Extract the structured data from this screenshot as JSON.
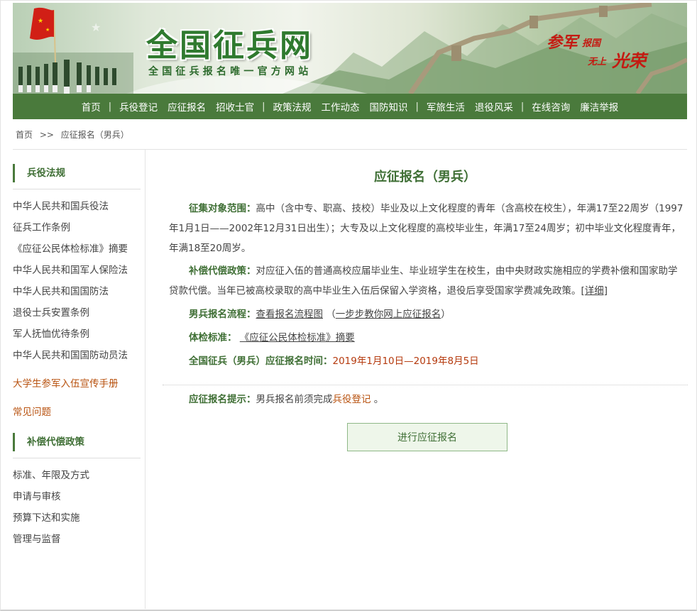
{
  "header": {
    "logo_title": "全国征兵网",
    "logo_subtitle": "全国征兵报名唯一官方网站",
    "slogan": {
      "part1": "参军",
      "part2": "报国",
      "part3": "无上",
      "part4": "光荣"
    }
  },
  "nav": {
    "items": [
      "首页",
      "兵役登记",
      "应征报名",
      "招收士官",
      "政策法规",
      "工作动态",
      "国防知识",
      "军旅生活",
      "退役风采",
      "在线咨询",
      "廉洁举报"
    ],
    "separator": "|"
  },
  "breadcrumb": {
    "home": "首页",
    "sep": ">>",
    "current": "应征报名（男兵）"
  },
  "sidebar": {
    "section1_title": "兵役法规",
    "section1_items": [
      "中华人民共和国兵役法",
      "征兵工作条例",
      "《应征公民体检标准》摘要",
      "中华人民共和国军人保险法",
      "中华人民共和国国防法",
      "退役士兵安置条例",
      "军人抚恤优待条例",
      "中华人民共和国国防动员法"
    ],
    "highlight_items": [
      "大学生参军入伍宣传手册",
      "常见问题"
    ],
    "section2_title": "补偿代偿政策",
    "section2_items": [
      "标准、年限及方式",
      "申请与审核",
      "预算下达和实施",
      "管理与监督"
    ]
  },
  "main": {
    "title": "应征报名（男兵）",
    "scope_label": "征集对象范围：",
    "scope_text": "高中（含中专、职高、技校）毕业及以上文化程度的青年（含高校在校生），年满17至22周岁（1997年1月1日——2002年12月31日出生）；大专及以上文化程度的高校毕业生，年满17至24周岁；初中毕业文化程度青年，年满18至20周岁。",
    "comp_label": "补偿代偿政策：",
    "comp_text": "对应征入伍的普通高校应届毕业生、毕业班学生在校生，由中央财政实施相应的学费补偿和国家助学贷款代偿。当年已被高校录取的高中毕业生入伍后保留入学资格，退役后享受国家学费减免政策。",
    "comp_link": "[详细]",
    "flow_label": "男兵报名流程：",
    "flow_link1": "查看报名流程图",
    "flow_open": "（",
    "flow_link2": "一步步教你网上应征报名",
    "flow_close": "）",
    "exam_label": "体检标准：",
    "exam_link": "《应征公民体检标准》摘要",
    "time_label": "全国征兵（男兵）应征报名时间：",
    "time_value": "2019年1月10日—2019年8月5日",
    "tip_label": "应征报名提示：",
    "tip_text": "男兵报名前须完成",
    "tip_link": "兵役登记",
    "tip_end": "。",
    "button_label": "进行应征报名"
  },
  "colors": {
    "brand_green": "#4a7a3c",
    "label_green": "#3f6f35",
    "accent_red": "#b53a0e",
    "accent_orange": "#b8520f"
  }
}
